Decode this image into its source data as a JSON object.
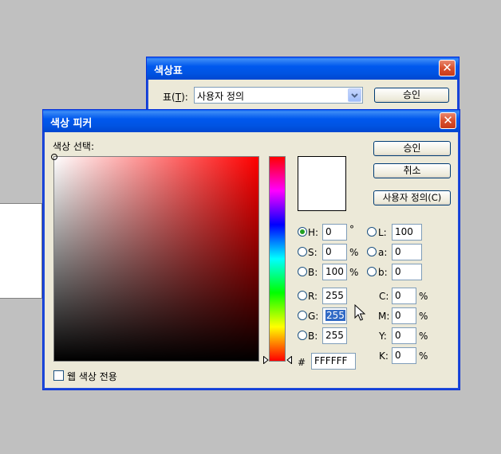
{
  "palette_window": {
    "title": "색상표",
    "table_label": "표(",
    "table_mnemonic": "T",
    "table_label_end": "):",
    "table_value": "사용자 정의",
    "ok_label": "승인"
  },
  "picker_window": {
    "title": "색상 피커",
    "select_label": "색상 선택:",
    "ok_label": "승인",
    "cancel_label": "취소",
    "custom_label": "사용자 정의(C)",
    "web_only_label": "웹 색상 전용",
    "web_only_checked": false,
    "hue_color": "#ff0000",
    "preview_color": "#ffffff",
    "hsb": [
      {
        "label": "H:",
        "value": "0",
        "unit": "°",
        "selected": true
      },
      {
        "label": "S:",
        "value": "0",
        "unit": "%",
        "selected": false
      },
      {
        "label": "B:",
        "value": "100",
        "unit": "%",
        "selected": false
      }
    ],
    "lab": [
      {
        "label": "L:",
        "value": "100"
      },
      {
        "label": "a:",
        "value": "0"
      },
      {
        "label": "b:",
        "value": "0"
      }
    ],
    "rgb": [
      {
        "label": "R:",
        "value": "255"
      },
      {
        "label": "G:",
        "value": "255"
      },
      {
        "label": "B:",
        "value": "255"
      }
    ],
    "cmyk": [
      {
        "label": "C:",
        "value": "0",
        "unit": "%"
      },
      {
        "label": "M:",
        "value": "0",
        "unit": "%"
      },
      {
        "label": "Y:",
        "value": "0",
        "unit": "%"
      },
      {
        "label": "K:",
        "value": "0",
        "unit": "%"
      }
    ],
    "hex_label": "#",
    "hex_value": "FFFFFF"
  },
  "icons": [
    "close-icon",
    "dropdown-arrow-icon",
    "slider-left-arrow-icon",
    "slider-right-arrow-icon",
    "mouse-pointer-icon"
  ]
}
